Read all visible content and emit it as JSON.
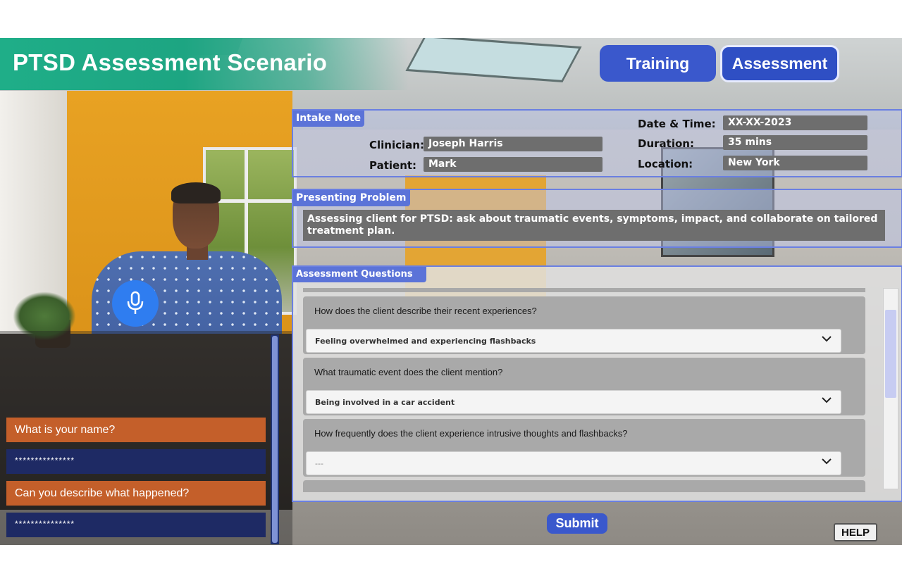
{
  "header": {
    "title": "PTSD Assessment Scenario"
  },
  "tabs": [
    {
      "label": "Training",
      "active": false
    },
    {
      "label": "Assessment",
      "active": true
    }
  ],
  "intake": {
    "section_label": "Intake Note",
    "clinician_label": "Clinician:",
    "clinician_value": "Joseph Harris",
    "patient_label": "Patient:",
    "patient_value": "Mark",
    "date_label": "Date & Time:",
    "date_value": "XX-XX-2023",
    "duration_label": "Duration:",
    "duration_value": "35 mins",
    "location_label": "Location:",
    "location_value": "New York"
  },
  "problem": {
    "section_label": "Presenting Problem",
    "text": "Assessing client for PTSD: ask about traumatic events, symptoms, impact, and collaborate on tailored treatment plan."
  },
  "questions": {
    "section_label": "Assessment Questions",
    "items": [
      {
        "question": "How does the client describe their recent experiences?",
        "answer": "Feeling overwhelmed and experiencing flashbacks"
      },
      {
        "question": "What traumatic event does the client mention?",
        "answer": "Being involved in a car accident"
      },
      {
        "question": "How frequently does the client experience intrusive thoughts and flashbacks?",
        "answer": "---"
      }
    ]
  },
  "chat": {
    "messages": [
      {
        "role": "clinician",
        "text": "What is your name?"
      },
      {
        "role": "patient",
        "text": "***************"
      },
      {
        "role": "clinician",
        "text": "Can you describe what happened?"
      },
      {
        "role": "patient",
        "text": "***************"
      }
    ]
  },
  "buttons": {
    "submit": "Submit",
    "help": "HELP"
  },
  "colors": {
    "accent": "#3a58cc",
    "title_bar": "#1fae88",
    "chat_question": "#c45f2a",
    "chat_answer": "#1e2a64"
  },
  "icons": {
    "mic": "microphone-icon",
    "dropdown": "chevron-down-icon"
  }
}
